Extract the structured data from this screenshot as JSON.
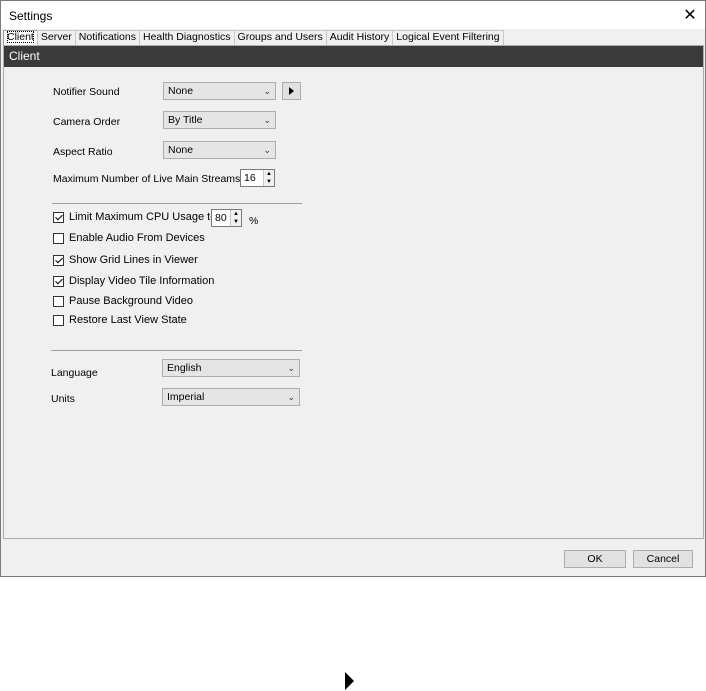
{
  "window": {
    "title": "Settings"
  },
  "tabs": [
    {
      "label": "Client"
    },
    {
      "label": "Server"
    },
    {
      "label": "Notifications"
    },
    {
      "label": "Health Diagnostics"
    },
    {
      "label": "Groups and Users"
    },
    {
      "label": "Audit History"
    },
    {
      "label": "Logical Event Filtering"
    }
  ],
  "panel": {
    "header": "Client",
    "notifier_sound": {
      "label": "Notifier Sound",
      "value": "None"
    },
    "camera_order": {
      "label": "Camera Order",
      "value": "By Title"
    },
    "aspect_ratio": {
      "label": "Aspect Ratio",
      "value": "None"
    },
    "max_streams": {
      "label": "Maximum Number of Live Main Streams",
      "value": "16"
    },
    "checkboxes": [
      {
        "label": "Limit Maximum CPU Usage to",
        "checked": true
      },
      {
        "label": "Enable Audio From Devices",
        "checked": false
      },
      {
        "label": "Show Grid Lines in Viewer",
        "checked": true
      },
      {
        "label": "Display Video Tile Information",
        "checked": true
      },
      {
        "label": "Pause Background Video",
        "checked": false
      },
      {
        "label": "Restore Last View State",
        "checked": false
      }
    ],
    "cpu_value": "80",
    "cpu_unit": "%",
    "language": {
      "label": "Language",
      "value": "English"
    },
    "units": {
      "label": "Units",
      "value": "Imperial"
    }
  },
  "footer": {
    "ok_label": "OK",
    "cancel_label": "Cancel"
  }
}
